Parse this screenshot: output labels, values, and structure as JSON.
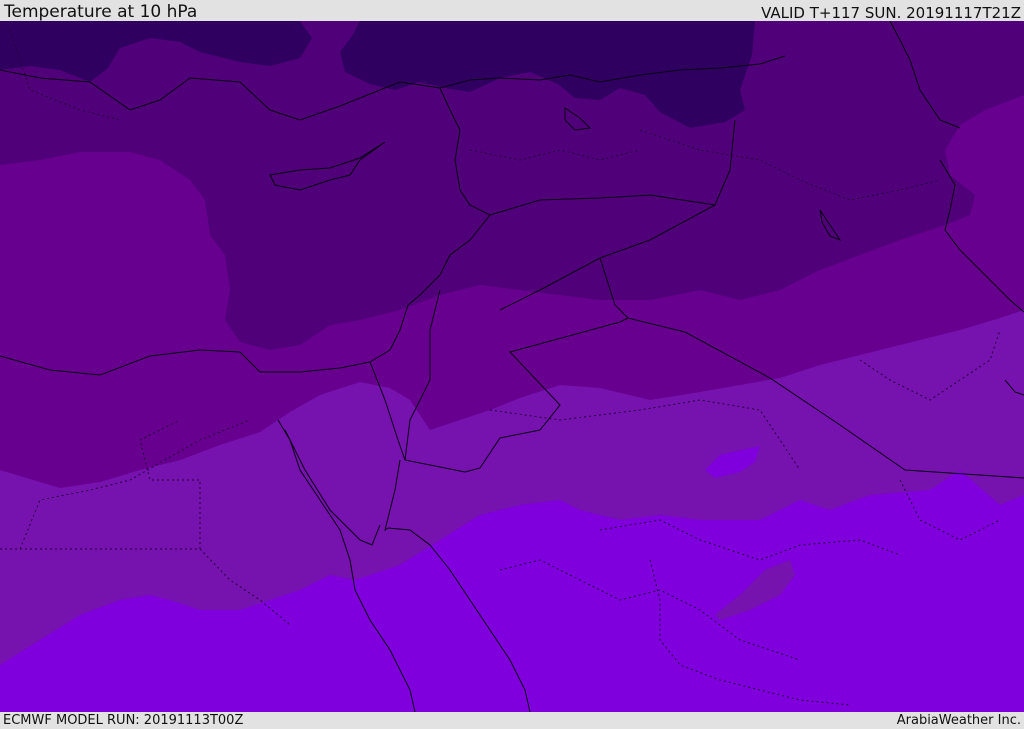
{
  "header": {
    "title": "Temperature at 10 hPa",
    "valid_time": "VALID T+117 SUN. 20191117T21Z"
  },
  "footer": {
    "model_run": "ECMWF MODEL RUN: 20191113T00Z",
    "credit": "ArabiaWeather Inc."
  },
  "map": {
    "layer": "temperature",
    "level_hpa": 10,
    "colors": {
      "band_coldest": "#300060",
      "band_cold": "#500078",
      "band_mid": "#67008e",
      "band_warm": "#7612ae",
      "band_warmest": "#7f00dc",
      "coastline": "#0a0014",
      "border": "#0a0014"
    }
  }
}
